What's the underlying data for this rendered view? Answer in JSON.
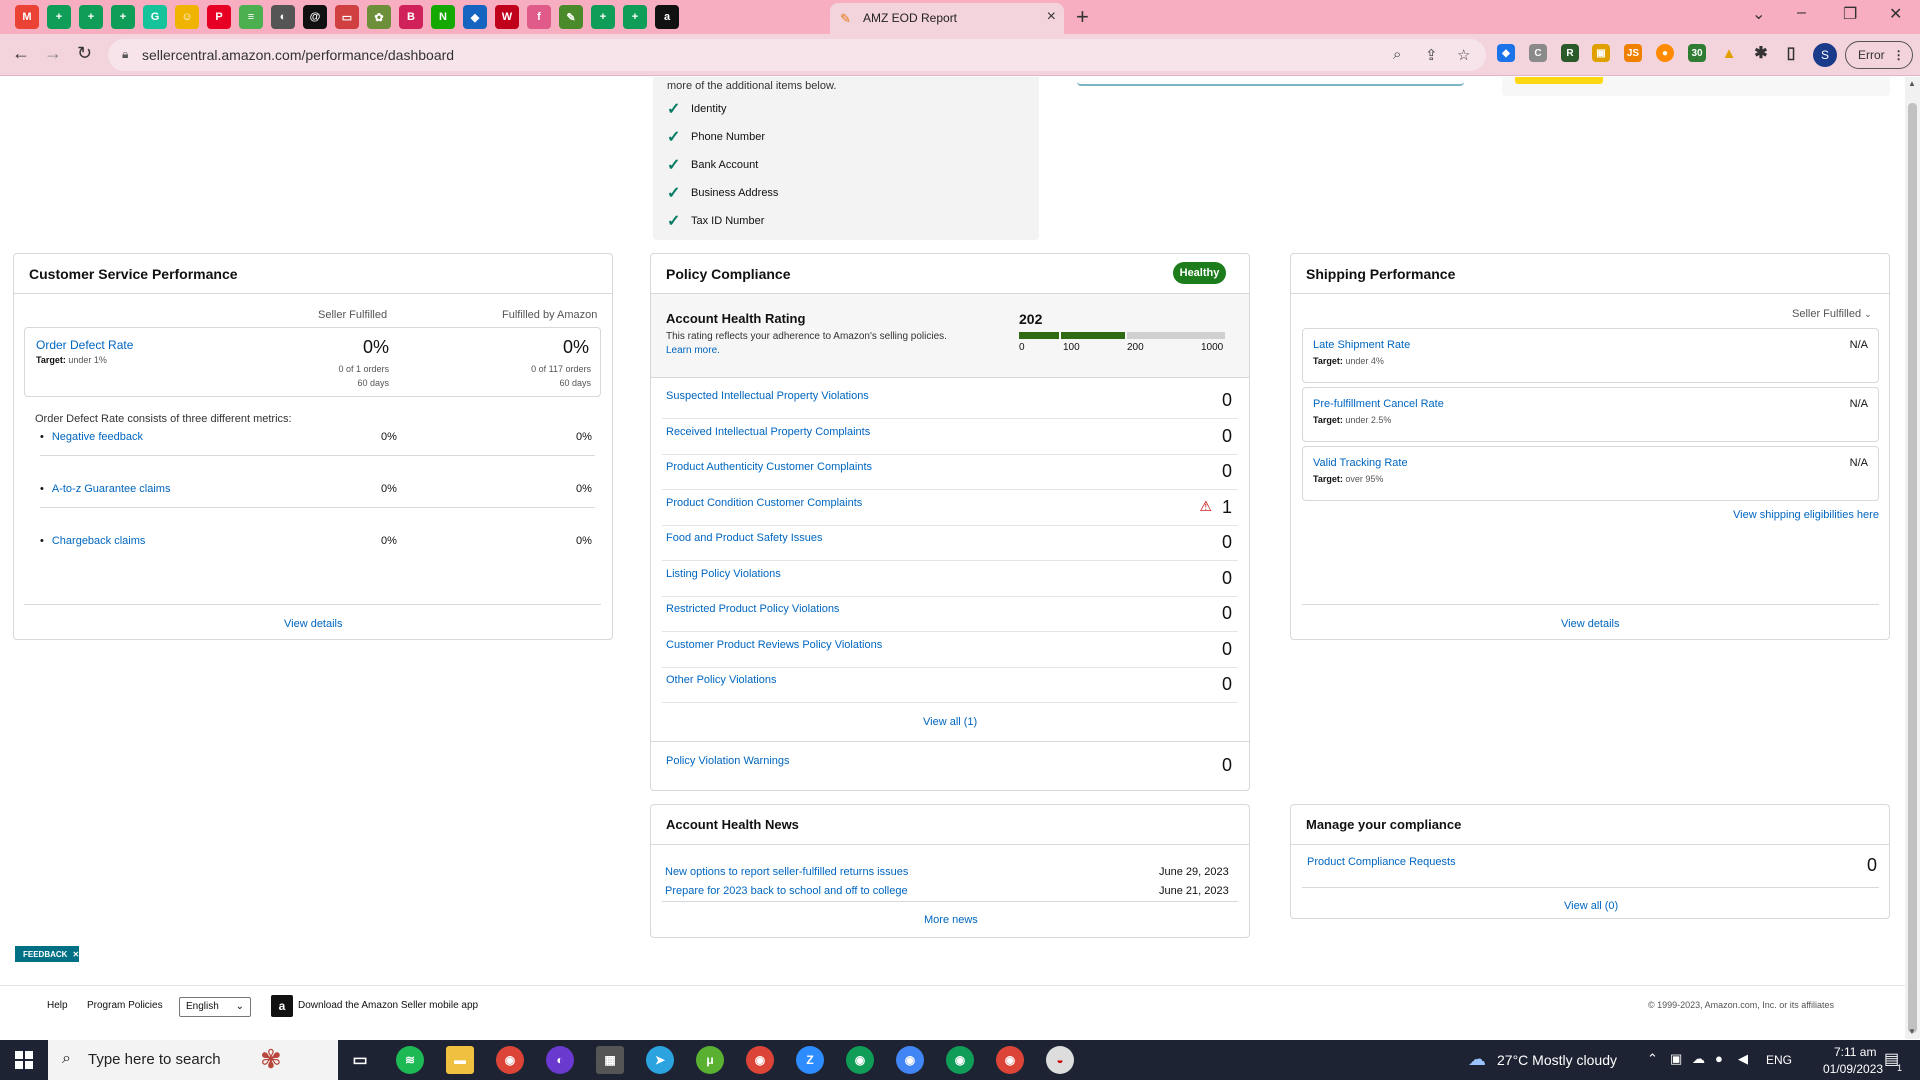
{
  "browser": {
    "active_tab_title": "AMZ EOD Report",
    "url": "sellercentral.amazon.com/performance/dashboard",
    "error_button": "Error",
    "profile_initial": "S",
    "pinned_tabs": [
      {
        "icon": "gmail-icon",
        "glyph": "M",
        "color": "#ea4335"
      },
      {
        "icon": "sheets-icon",
        "glyph": "+",
        "color": "#0f9d58"
      },
      {
        "icon": "sheets-icon",
        "glyph": "+",
        "color": "#0f9d58"
      },
      {
        "icon": "sheets-icon",
        "glyph": "+",
        "color": "#0f9d58"
      },
      {
        "icon": "grammarly-icon",
        "glyph": "G",
        "color": "#15c39a"
      },
      {
        "icon": "emoji-icon",
        "glyph": "☺",
        "color": "#f0b400"
      },
      {
        "icon": "pinterest-icon",
        "glyph": "P",
        "color": "#e60023"
      },
      {
        "icon": "notes-icon",
        "glyph": "≡",
        "color": "#4caf50"
      },
      {
        "icon": "globe-icon",
        "glyph": "◐",
        "color": "#555555"
      },
      {
        "icon": "threads-icon",
        "glyph": "@",
        "color": "#111111"
      },
      {
        "icon": "page-icon",
        "glyph": "▭",
        "color": "#d04040"
      },
      {
        "icon": "plant-icon",
        "glyph": "✿",
        "color": "#6d8f3a"
      },
      {
        "icon": "b-icon",
        "glyph": "B",
        "color": "#d0215a"
      },
      {
        "icon": "upwork-icon",
        "glyph": "N",
        "color": "#14a800"
      },
      {
        "icon": "diamond-icon",
        "glyph": "◆",
        "color": "#1565c0"
      },
      {
        "icon": "w-icon",
        "glyph": "W",
        "color": "#c0001a"
      },
      {
        "icon": "fiverr-icon",
        "glyph": "f",
        "color": "#e05a8a"
      },
      {
        "icon": "leaf-icon",
        "glyph": "✎",
        "color": "#4a8a2a"
      },
      {
        "icon": "sheets-icon",
        "glyph": "+",
        "color": "#0f9d58"
      },
      {
        "icon": "sheets-icon",
        "glyph": "+",
        "color": "#0f9d58"
      },
      {
        "icon": "amazon-icon",
        "glyph": "a",
        "color": "#111111"
      }
    ]
  },
  "verification": {
    "intro": "more of the additional items below.",
    "items": [
      "Identity",
      "Phone Number",
      "Bank Account",
      "Business Address",
      "Tax ID Number"
    ]
  },
  "csp": {
    "title": "Customer Service Performance",
    "col_seller": "Seller Fulfilled",
    "col_fba": "Fulfilled by Amazon",
    "odr_label": "Order Defect Rate",
    "odr_target_label": "Target:",
    "odr_target": "under 1%",
    "sf_pct": "0%",
    "sf_orders": "0 of 1 orders",
    "sf_days": "60 days",
    "fba_pct": "0%",
    "fba_orders": "0 of 117 orders",
    "fba_days": "60 days",
    "metrics_intro": "Order Defect Rate consists of three different metrics:",
    "metrics": [
      {
        "label": "Negative feedback",
        "sf": "0%",
        "fba": "0%"
      },
      {
        "label": "A-to-z Guarantee claims",
        "sf": "0%",
        "fba": "0%"
      },
      {
        "label": "Chargeback claims",
        "sf": "0%",
        "fba": "0%"
      }
    ],
    "view_details": "View details"
  },
  "policy": {
    "title": "Policy Compliance",
    "status": "Healthy",
    "ahr_title": "Account Health Rating",
    "ahr_desc": "This rating reflects your adherence to Amazon's selling policies.",
    "learn_more": "Learn more.",
    "ahr_value": "202",
    "ahr_score": 202,
    "scale": [
      "0",
      "100",
      "200",
      "1000"
    ],
    "rows": [
      {
        "label": "Suspected Intellectual Property Violations",
        "count": "0",
        "warn": false
      },
      {
        "label": "Received Intellectual Property Complaints",
        "count": "0",
        "warn": false
      },
      {
        "label": "Product Authenticity Customer Complaints",
        "count": "0",
        "warn": false
      },
      {
        "label": "Product Condition Customer Complaints",
        "count": "1",
        "warn": true
      },
      {
        "label": "Food and Product Safety Issues",
        "count": "0",
        "warn": false
      },
      {
        "label": "Listing Policy Violations",
        "count": "0",
        "warn": false
      },
      {
        "label": "Restricted Product Policy Violations",
        "count": "0",
        "warn": false
      },
      {
        "label": "Customer Product Reviews Policy Violations",
        "count": "0",
        "warn": false
      },
      {
        "label": "Other Policy Violations",
        "count": "0",
        "warn": false
      }
    ],
    "view_all": "View all (1)",
    "warnings_label": "Policy Violation Warnings",
    "warnings_count": "0"
  },
  "shipping": {
    "title": "Shipping Performance",
    "filter": "Seller Fulfilled",
    "metrics": [
      {
        "label": "Late Shipment Rate",
        "target_label": "Target:",
        "target": "under 4%",
        "value": "N/A"
      },
      {
        "label": "Pre-fulfillment Cancel Rate",
        "target_label": "Target:",
        "target": "under 2.5%",
        "value": "N/A"
      },
      {
        "label": "Valid Tracking Rate",
        "target_label": "Target:",
        "target": "over 95%",
        "value": "N/A"
      }
    ],
    "eligibility_link": "View shipping eligibilities here",
    "view_details": "View details"
  },
  "news": {
    "title": "Account Health News",
    "items": [
      {
        "label": "New options to report seller-fulfilled returns issues",
        "date": "June 29, 2023"
      },
      {
        "label": "Prepare for 2023 back to school and off to college",
        "date": "June 21, 2023"
      }
    ],
    "more": "More news"
  },
  "compliance": {
    "title": "Manage your compliance",
    "label": "Product Compliance Requests",
    "count": "0",
    "view_all": "View all (0)"
  },
  "footer": {
    "help": "Help",
    "program_policies": "Program Policies",
    "language": "English",
    "app_link": "Download the Amazon Seller mobile app",
    "copyright": "© 1999-2023, Amazon.com, Inc. or its affiliates",
    "feedback": "FEEDBACK"
  },
  "taskbar": {
    "search_placeholder": "Type here to search",
    "weather": "27°C  Mostly cloudy",
    "lang": "ENG",
    "time": "7:11 am",
    "date": "01/09/2023",
    "notif_count": "1"
  },
  "colors": {
    "accent_link": "#0066c0",
    "healthy_green": "#1d7d1d",
    "tab_bar_pink": "#f7aec0"
  }
}
